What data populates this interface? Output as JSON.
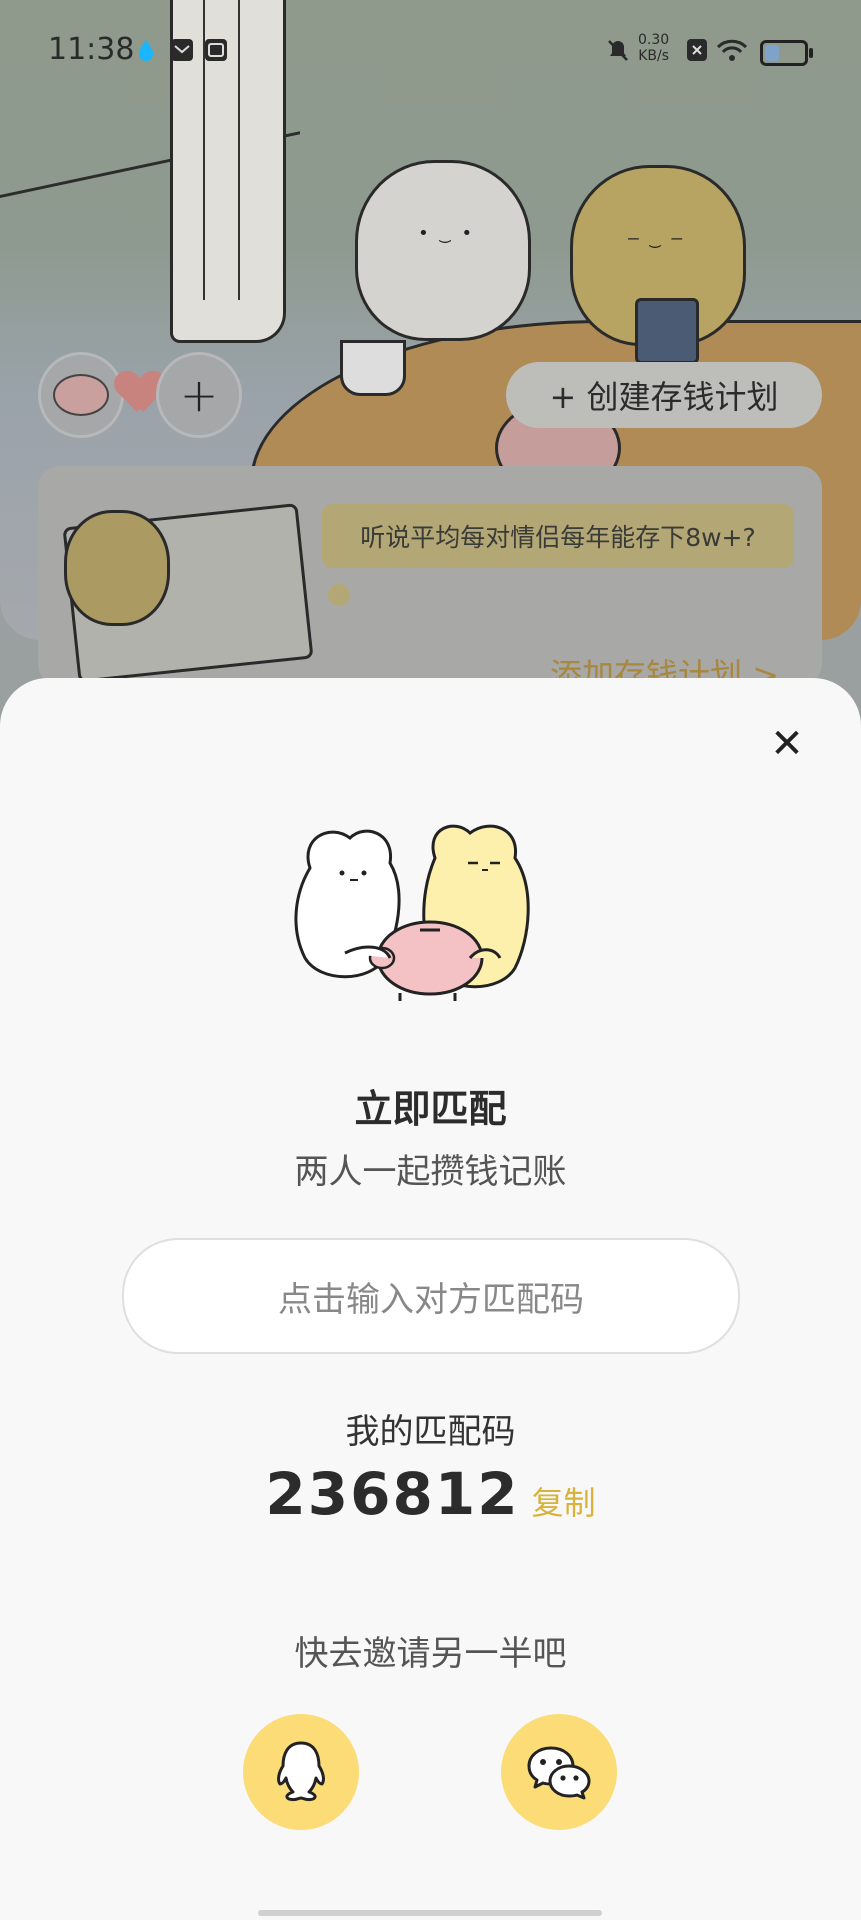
{
  "status_bar": {
    "time": "11:38",
    "net_speed_value": "0.30",
    "net_speed_unit": "KB/s"
  },
  "background": {
    "create_plan_label": "+ 创建存钱计划",
    "card_bubble": "听说平均每对情侣每年能存下8w+?",
    "card_link": "添加存钱计划 >"
  },
  "sheet": {
    "title": "立即匹配",
    "subtitle": "两人一起攒钱记账",
    "input_placeholder": "点击输入对方匹配码",
    "my_code_label": "我的匹配码",
    "my_code": "236812",
    "copy_label": "复制",
    "invite_text": "快去邀请另一半吧"
  },
  "icons": {
    "close": "close-icon",
    "qq": "qq-icon",
    "wechat": "wechat-icon"
  },
  "colors": {
    "accent_yellow": "#fbdc77",
    "copy_text": "#d9b23a",
    "sheet_bg": "#f8f8f8"
  }
}
